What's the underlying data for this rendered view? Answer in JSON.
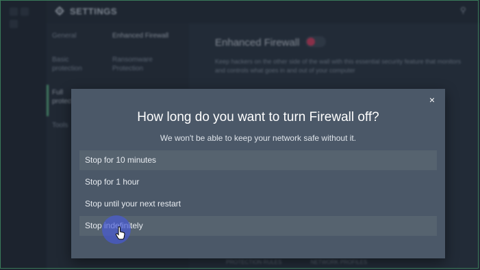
{
  "header": {
    "title": "SETTINGS"
  },
  "nav": {
    "col1": [
      {
        "label": "General"
      },
      {
        "label": "Basic protection"
      },
      {
        "label": "Full protection",
        "active": true
      },
      {
        "label": "Tools"
      }
    ],
    "col2": [
      {
        "label": "Enhanced Firewall",
        "active": true
      },
      {
        "label": "Ransomware Protection"
      }
    ]
  },
  "content": {
    "title": "Enhanced Firewall",
    "toggle_state": "on",
    "description": "Keep hackers on the other side of the wall with this essential security feature that monitors and controls what goes in and out of your computer",
    "bottom_tabs": [
      "PROTECTION RULES",
      "NETWORK PROFILES"
    ]
  },
  "dialog": {
    "title": "How long do you want to turn Firewall off?",
    "subtitle": "We won't be able to keep your network safe without it.",
    "close_label": "×",
    "options": [
      {
        "label": "Stop for 10 minutes",
        "highlighted": true
      },
      {
        "label": "Stop for 1 hour",
        "highlighted": false
      },
      {
        "label": "Stop until your next restart",
        "highlighted": false
      },
      {
        "label": "Stop indefinitely",
        "highlighted": true
      }
    ]
  },
  "colors": {
    "accent_green": "#5fc08a",
    "toggle_red": "#e0395c",
    "modal_bg": "#4b5868",
    "option_highlight": "#56636f",
    "cursor_halo": "#4658dc"
  },
  "icons": [
    "gear-icon",
    "search-icon",
    "close-icon",
    "cursor-icon"
  ]
}
